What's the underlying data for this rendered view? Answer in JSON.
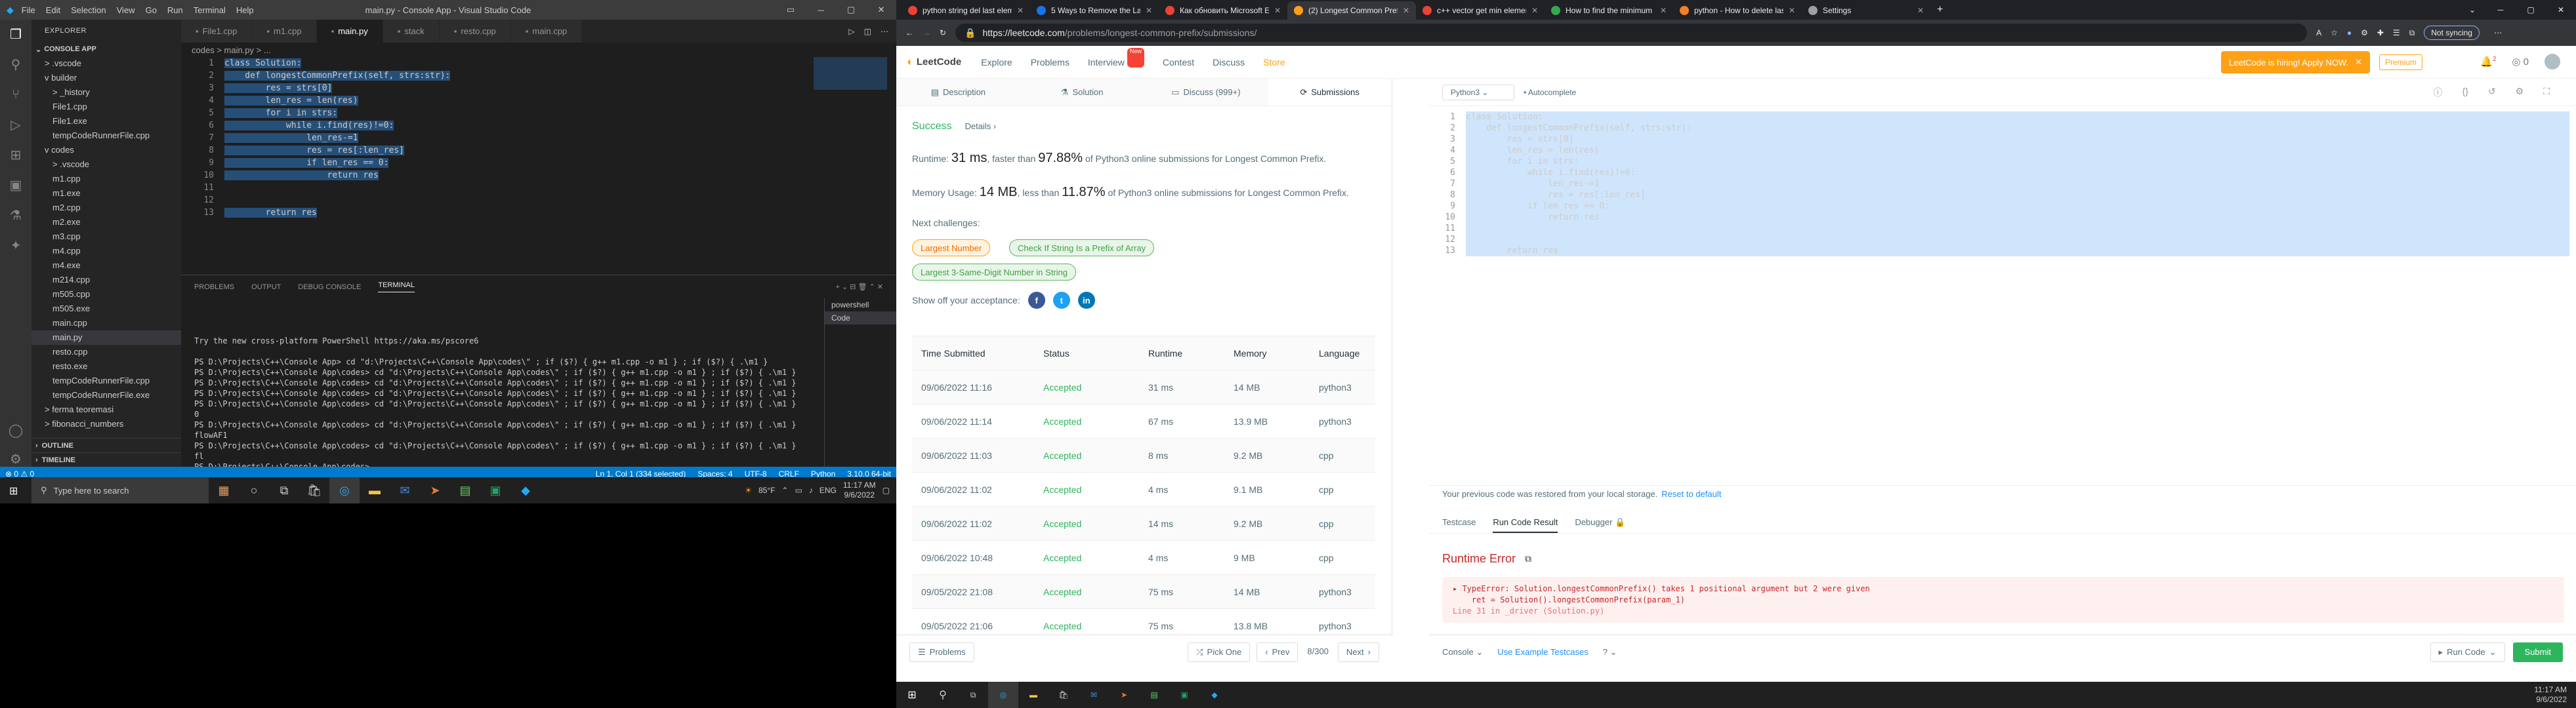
{
  "vscode": {
    "menu": [
      "File",
      "Edit",
      "Selection",
      "View",
      "Go",
      "Run",
      "Terminal",
      "Help"
    ],
    "title": "main.py - Console App - Visual Studio Code",
    "explorer_header": "EXPLORER",
    "section": "CONSOLE APP",
    "tree": [
      {
        "label": "> .vscode",
        "indent": 1
      },
      {
        "label": "v builder",
        "indent": 1
      },
      {
        "label": "> _history",
        "indent": 2
      },
      {
        "label": "File1.cpp",
        "indent": 2
      },
      {
        "label": "File1.exe",
        "indent": 2
      },
      {
        "label": "tempCodeRunnerFile.cpp",
        "indent": 2
      },
      {
        "label": "v codes",
        "indent": 1
      },
      {
        "label": "> .vscode",
        "indent": 2
      },
      {
        "label": "m1.cpp",
        "indent": 2
      },
      {
        "label": "m1.exe",
        "indent": 2
      },
      {
        "label": "m2.cpp",
        "indent": 2
      },
      {
        "label": "m2.exe",
        "indent": 2
      },
      {
        "label": "m3.cpp",
        "indent": 2
      },
      {
        "label": "m4.cpp",
        "indent": 2
      },
      {
        "label": "m4.exe",
        "indent": 2
      },
      {
        "label": "m214.cpp",
        "indent": 2
      },
      {
        "label": "m505.cpp",
        "indent": 2
      },
      {
        "label": "m505.exe",
        "indent": 2
      },
      {
        "label": "main.cpp",
        "indent": 2
      },
      {
        "label": "main.py",
        "indent": 2,
        "selected": true
      },
      {
        "label": "resto.cpp",
        "indent": 2
      },
      {
        "label": "resto.exe",
        "indent": 2
      },
      {
        "label": "tempCodeRunnerFile.cpp",
        "indent": 2
      },
      {
        "label": "tempCodeRunnerFile.exe",
        "indent": 2
      },
      {
        "label": "> ferma teoremasi",
        "indent": 1
      },
      {
        "label": "> fibonacci_numbers",
        "indent": 1
      }
    ],
    "outline": "OUTLINE",
    "timeline": "TIMELINE",
    "tabs": [
      {
        "label": "File1.cpp",
        "active": false
      },
      {
        "label": "m1.cpp",
        "active": false
      },
      {
        "label": "main.py",
        "active": true
      },
      {
        "label": "stack",
        "active": false
      },
      {
        "label": "resto.cpp",
        "active": false
      },
      {
        "label": "main.cpp",
        "active": false
      }
    ],
    "breadcrumb": "codes > main.py > ...",
    "code": [
      "class Solution:",
      "    def longestCommonPrefix(self, strs:str):",
      "        res = strs[0]",
      "        len_res = len(res)",
      "        for i in strs:",
      "            while i.find(res)!=0:",
      "                len_res-=1",
      "                res = res[:len_res]",
      "                if len_res == 0:",
      "                    return res",
      "",
      "",
      "        return res"
    ],
    "panel_tabs": [
      "PROBLEMS",
      "OUTPUT",
      "DEBUG CONSOLE",
      "TERMINAL"
    ],
    "terminal": [
      "",
      "",
      "Try the new cross-platform PowerShell https://aka.ms/pscore6",
      "",
      "PS D:\\Projects\\C++\\Console App> cd \"d:\\Projects\\C++\\Console App\\codes\\\" ; if ($?) { g++ m1.cpp -o m1 } ; if ($?) { .\\m1 }",
      "PS D:\\Projects\\C++\\Console App\\codes> cd \"d:\\Projects\\C++\\Console App\\codes\\\" ; if ($?) { g++ m1.cpp -o m1 } ; if ($?) { .\\m1 }",
      "PS D:\\Projects\\C++\\Console App\\codes> cd \"d:\\Projects\\C++\\Console App\\codes\\\" ; if ($?) { g++ m1.cpp -o m1 } ; if ($?) { .\\m1 }",
      "PS D:\\Projects\\C++\\Console App\\codes> cd \"d:\\Projects\\C++\\Console App\\codes\\\" ; if ($?) { g++ m1.cpp -o m1 } ; if ($?) { .\\m1 }",
      "PS D:\\Projects\\C++\\Console App\\codes> cd \"d:\\Projects\\C++\\Console App\\codes\\\" ; if ($?) { g++ m1.cpp -o m1 } ; if ($?) { .\\m1 }",
      "0",
      "PS D:\\Projects\\C++\\Console App\\codes> cd \"d:\\Projects\\C++\\Console App\\codes\\\" ; if ($?) { g++ m1.cpp -o m1 } ; if ($?) { .\\m1 }",
      "flowAF1",
      "PS D:\\Projects\\C++\\Console App\\codes> cd \"d:\\Projects\\C++\\Console App\\codes\\\" ; if ($?) { g++ m1.cpp -o m1 } ; if ($?) { .\\m1 }",
      "fl",
      "PS D:\\Projects\\C++\\Console App\\codes> "
    ],
    "term_list": [
      "powershell",
      "Code"
    ],
    "status_left": "⊗ 0 ⚠ 0",
    "status_right": [
      "Ln 1, Col 1 (334 selected)",
      "Spaces: 4",
      "UTF-8",
      "CRLF",
      "Python",
      "3.10.0 64-bit"
    ]
  },
  "taskbar_left": {
    "search_placeholder": "Type here to search",
    "weather": "85°F",
    "lang": "ENG",
    "time": "11:17 AM",
    "date": "9/6/2022"
  },
  "chrome": {
    "tabs": [
      {
        "label": "python string del last element -",
        "color": "#ea4335",
        "active": false
      },
      {
        "label": "5 Ways to Remove the Last Cha",
        "color": "#1a73e8",
        "active": false
      },
      {
        "label": "Как обновить Microsoft Edge в",
        "color": "#ea4335",
        "active": false
      },
      {
        "label": "(2) Longest Common Prefix - Le",
        "color": "#ffa116",
        "active": true
      },
      {
        "label": "c++ vector get min element - ",
        "color": "#ea4335",
        "active": false
      },
      {
        "label": "How to find the minimum and m",
        "color": "#34a853",
        "active": false
      },
      {
        "label": "python - How to delete last item",
        "color": "#f48024",
        "active": false
      },
      {
        "label": "Settings",
        "color": "#9aa0a6",
        "active": false
      }
    ],
    "url_host": "https://leetcode.com",
    "url_path": "/problems/longest-common-prefix/submissions/",
    "sync": "Not syncing"
  },
  "leetcode": {
    "logo": "LeetCode",
    "nav": [
      "Explore",
      "Problems",
      "Interview",
      "Contest",
      "Discuss",
      "Store"
    ],
    "new_badge": "New",
    "promo": "LeetCode is hiring! Apply NOW.",
    "premium": "Premium",
    "notif_count": "2",
    "coins": "0",
    "tabs": [
      "Description",
      "Solution",
      "Discuss (999+)",
      "Submissions"
    ],
    "result_status": "Success",
    "details": "Details",
    "runtime_label": "Runtime:",
    "runtime_value": "31 ms",
    "runtime_mid": ", faster than",
    "runtime_pct": "97.88%",
    "runtime_tail": "of Python3 online submissions for Longest Common Prefix.",
    "memory_label": "Memory Usage:",
    "memory_value": "14 MB",
    "memory_mid": ", less than",
    "memory_pct": "11.87%",
    "memory_tail": "of Python3 online submissions for Longest Common Prefix.",
    "next_challenges": "Next challenges:",
    "challenges": [
      "Largest Number",
      "Check If String Is a Prefix of Array",
      "Largest 3-Same-Digit Number in String"
    ],
    "share_text": "Show off your acceptance:",
    "table_headers": [
      "Time Submitted",
      "Status",
      "Runtime",
      "Memory",
      "Language"
    ],
    "submissions": [
      [
        "09/06/2022 11:16",
        "Accepted",
        "31 ms",
        "14 MB",
        "python3"
      ],
      [
        "09/06/2022 11:14",
        "Accepted",
        "67 ms",
        "13.9 MB",
        "python3"
      ],
      [
        "09/06/2022 11:03",
        "Accepted",
        "8 ms",
        "9.2 MB",
        "cpp"
      ],
      [
        "09/06/2022 11:02",
        "Accepted",
        "4 ms",
        "9.1 MB",
        "cpp"
      ],
      [
        "09/06/2022 11:02",
        "Accepted",
        "14 ms",
        "9.2 MB",
        "cpp"
      ],
      [
        "09/06/2022 10:48",
        "Accepted",
        "4 ms",
        "9 MB",
        "cpp"
      ],
      [
        "09/05/2022 21:08",
        "Accepted",
        "75 ms",
        "14 MB",
        "python3"
      ],
      [
        "09/05/2022 21:06",
        "Accepted",
        "75 ms",
        "13.8 MB",
        "python3"
      ]
    ],
    "footer_problems": "Problems",
    "footer_pick": "Pick One",
    "footer_prev": "Prev",
    "footer_page": "8/300",
    "footer_next": "Next",
    "lang_select": "Python3",
    "autocomplete": "Autocomplete",
    "editor_code": [
      "class Solution:",
      "    def longestCommonPrefix(self, strs:str):",
      "        res = strs[0]",
      "        len_res = len(res)",
      "        for i in strs:",
      "            while i.find(res)!=0:",
      "                len_res-=1",
      "                res = res[:len_res]",
      "            if len_res == 0:",
      "                return res",
      "",
      "",
      "        return res"
    ],
    "restore_text": "Your previous code was restored from your local storage.",
    "reset_link": "Reset to default",
    "result_tabs": [
      "Testcase",
      "Run Code Result",
      "Debugger"
    ],
    "runtime_error": "Runtime Error",
    "error_lines": [
      "TypeError: Solution.longestCommonPrefix() takes 1 positional argument but 2 were given",
      "    ret = Solution().longestCommonPrefix(param_1)",
      "Line 31 in _driver (Solution.py)"
    ],
    "console": "Console",
    "example": "Use Example Testcases",
    "run_code": "Run Code",
    "submit": "Submit"
  },
  "taskbar_right": {
    "time": "11:17 AM",
    "date": "9/6/2022"
  }
}
